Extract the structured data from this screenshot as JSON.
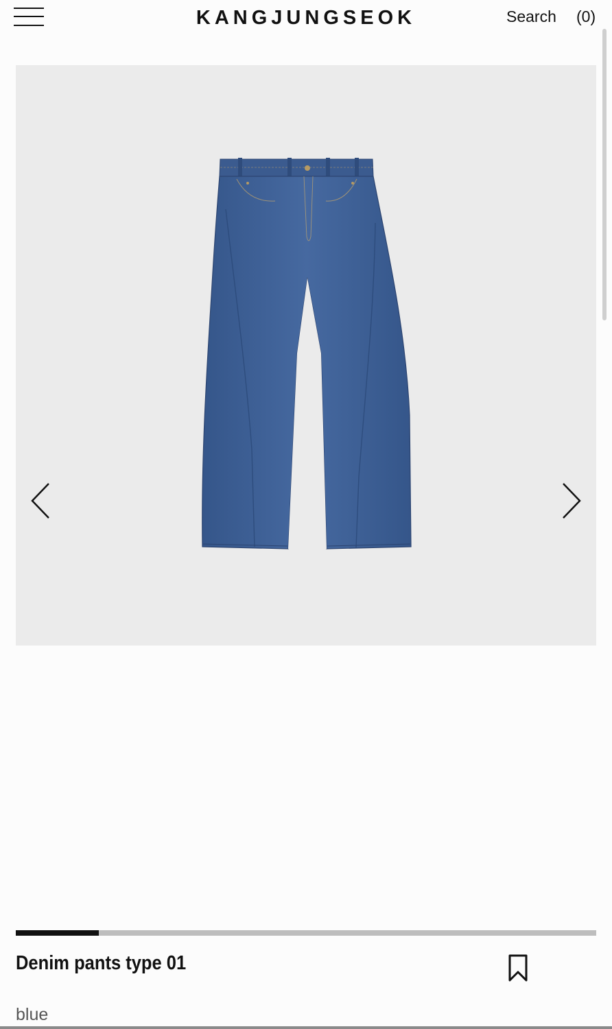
{
  "header": {
    "brand": "KANGJUNGSEOK",
    "search_label": "Search",
    "cart_label": "(0)",
    "menu_icon": "hamburger-menu-icon"
  },
  "gallery": {
    "image_subject": "blue wide-leg denim jeans",
    "background_color": "#ebebeb",
    "prev_icon": "chevron-left-icon",
    "next_icon": "chevron-right-icon",
    "progress_fraction": 0.143
  },
  "product": {
    "name": "Denim pants type 01",
    "color": "blue",
    "bookmark_icon": "bookmark-icon"
  },
  "colors": {
    "text": "#111111",
    "denim": "#3d5f94",
    "track": "#bdbdbd"
  }
}
